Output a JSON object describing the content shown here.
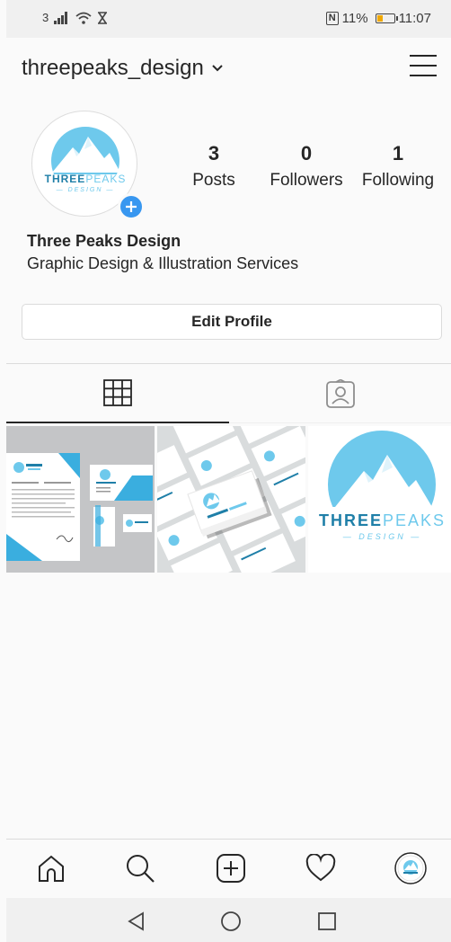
{
  "status_bar": {
    "sim": "3",
    "nfc": "N",
    "battery_percent": "11%",
    "battery_level": 0.11,
    "time": "11:07"
  },
  "header": {
    "username": "threepeaks_design",
    "menu_icon": "hamburger-icon"
  },
  "profile": {
    "logo_word1": "THREE",
    "logo_word2": "PEAKS",
    "logo_sub": "DESIGN",
    "stats": [
      {
        "value": "3",
        "label": "Posts"
      },
      {
        "value": "0",
        "label": "Followers"
      },
      {
        "value": "1",
        "label": "Following"
      }
    ],
    "name": "Three Peaks Design",
    "bio": "Graphic Design & Illustration Services",
    "edit_label": "Edit Profile"
  },
  "tabs": [
    {
      "icon": "grid-icon",
      "active": true
    },
    {
      "icon": "tagged-icon",
      "active": false
    }
  ],
  "posts": [
    {
      "kind": "stationery-mockup"
    },
    {
      "kind": "business-cards-mockup",
      "card_text": "Paul Quinlan"
    },
    {
      "kind": "logo",
      "word1": "THREE",
      "word2": "PEAKS",
      "sub": "DESIGN"
    }
  ],
  "bottom_nav": [
    "home-icon",
    "search-icon",
    "new-post-icon",
    "heart-icon",
    "profile-avatar"
  ],
  "android_nav": [
    "back-icon",
    "home-circle-icon",
    "recents-icon"
  ],
  "colors": {
    "accent": "#3897f0",
    "logo_blue": "#6ec9ec",
    "logo_dark": "#1f7fa8",
    "text": "#262626"
  }
}
